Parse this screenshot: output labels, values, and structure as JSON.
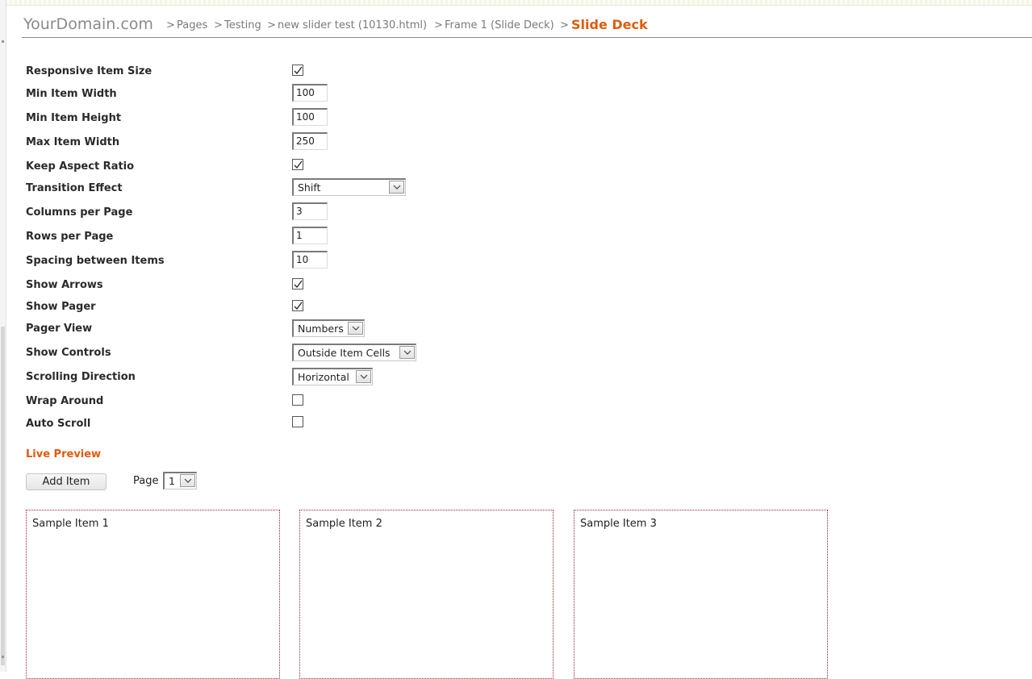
{
  "breadcrumb": {
    "site": "YourDomain.com",
    "separator": ">",
    "items": [
      "Pages",
      "Testing",
      "new slider test (10130.html)",
      "Frame 1 (Slide Deck)"
    ],
    "current": "Slide Deck"
  },
  "settings": {
    "responsive_item_size": {
      "label": "Responsive Item Size",
      "checked": true
    },
    "min_item_width": {
      "label": "Min Item Width",
      "value": "100"
    },
    "min_item_height": {
      "label": "Min Item Height",
      "value": "100"
    },
    "max_item_width": {
      "label": "Max Item Width",
      "value": "250"
    },
    "keep_aspect_ratio": {
      "label": "Keep Aspect Ratio",
      "checked": true
    },
    "transition_effect": {
      "label": "Transition Effect",
      "value": "Shift"
    },
    "columns_per_page": {
      "label": "Columns per Page",
      "value": "3"
    },
    "rows_per_page": {
      "label": "Rows per Page",
      "value": "1"
    },
    "spacing_between_items": {
      "label": "Spacing between Items",
      "value": "10"
    },
    "show_arrows": {
      "label": "Show Arrows",
      "checked": true
    },
    "show_pager": {
      "label": "Show Pager",
      "checked": true
    },
    "pager_view": {
      "label": "Pager View",
      "value": "Numbers"
    },
    "show_controls": {
      "label": "Show Controls",
      "value": "Outside Item Cells"
    },
    "scrolling_direction": {
      "label": "Scrolling Direction",
      "value": "Horizontal"
    },
    "wrap_around": {
      "label": "Wrap Around",
      "checked": false
    },
    "auto_scroll": {
      "label": "Auto Scroll",
      "checked": false
    }
  },
  "preview": {
    "title": "Live Preview",
    "add_item_label": "Add Item",
    "page_label": "Page",
    "page_value": "1",
    "items": [
      "Sample Item 1",
      "Sample Item 2",
      "Sample Item 3"
    ]
  },
  "icons": {
    "checkmark": "checkmark-icon",
    "dropdown": "chevron-down-icon"
  }
}
